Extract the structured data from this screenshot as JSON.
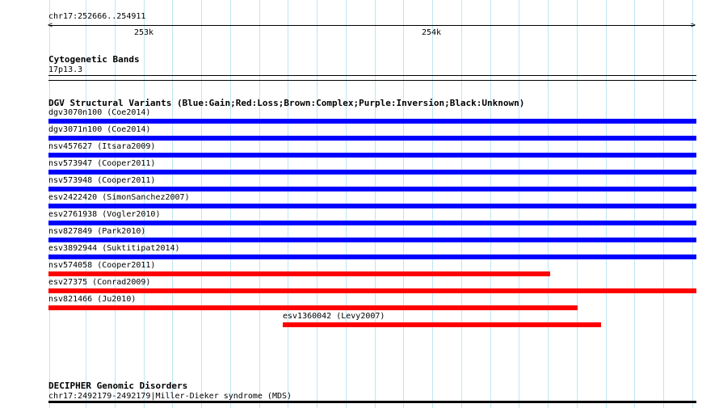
{
  "ruler": {
    "range_label": "chr17:252666..254911",
    "ticks": [
      "253k",
      "254k"
    ]
  },
  "cytoband": {
    "title": "Cytogenetic Bands",
    "band": "17p13.3"
  },
  "dgv": {
    "title": "DGV Structural Variants (Blue:Gain;Red:Loss;Brown:Complex;Purple:Inversion;Black:Unknown)",
    "colors": {
      "gain": "#0000ff",
      "loss": "#ff0000"
    },
    "variants": [
      {
        "label": "dgv3070n100 (Coe2014)",
        "type": "gain"
      },
      {
        "label": "dgv3071n100 (Coe2014)",
        "type": "gain"
      },
      {
        "label": "nsv457627 (Itsara2009)",
        "type": "gain"
      },
      {
        "label": "nsv573947 (Cooper2011)",
        "type": "gain"
      },
      {
        "label": "nsv573948 (Cooper2011)",
        "type": "gain"
      },
      {
        "label": "esv2422420 (SimonSanchez2007)",
        "type": "gain"
      },
      {
        "label": "esv2761938 (Vogler2010)",
        "type": "gain"
      },
      {
        "label": "nsv827849 (Park2010)",
        "type": "gain"
      },
      {
        "label": "esv3892944 (Suktitipat2014)",
        "type": "gain"
      },
      {
        "label": "nsv574058 (Cooper2011)",
        "type": "loss"
      },
      {
        "label": "esv27375 (Conrad2009)",
        "type": "loss"
      },
      {
        "label": "nsv821466 (Ju2010)",
        "type": "loss"
      },
      {
        "label": "esv1360042 (Levy2007)",
        "type": "loss"
      }
    ]
  },
  "decipher": {
    "title": "DECIPHER Genomic Disorders",
    "entry": "chr17:2492179-2492179|Miller-Dieker syndrome (MDS)"
  }
}
